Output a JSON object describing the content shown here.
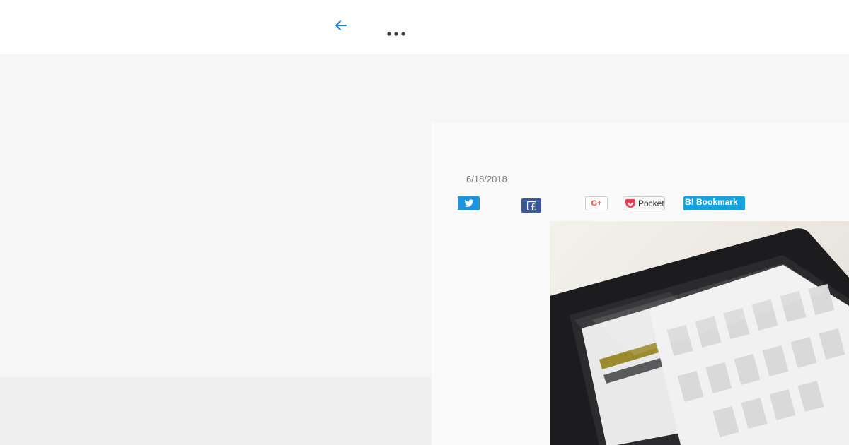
{
  "toolbar": {
    "back_icon": "arrow-left-icon",
    "more_icon": "more-horizontal-icon",
    "accent_color": "#1b7fd6"
  },
  "article": {
    "date": "6/18/2018",
    "image_alt": "tablet-manga-library"
  },
  "share": {
    "twitter_icon": "twitter-icon",
    "facebook_icon": "facebook-icon",
    "gplus_label": "G+",
    "pocket_label": "Pocket",
    "hatena_label": "B! Bookmark"
  },
  "colors": {
    "twitter": "#1b95e0",
    "facebook": "#3b5998",
    "gplus": "#dd4b39",
    "pocket": "#ee4056",
    "hatena": "#17a2de"
  }
}
